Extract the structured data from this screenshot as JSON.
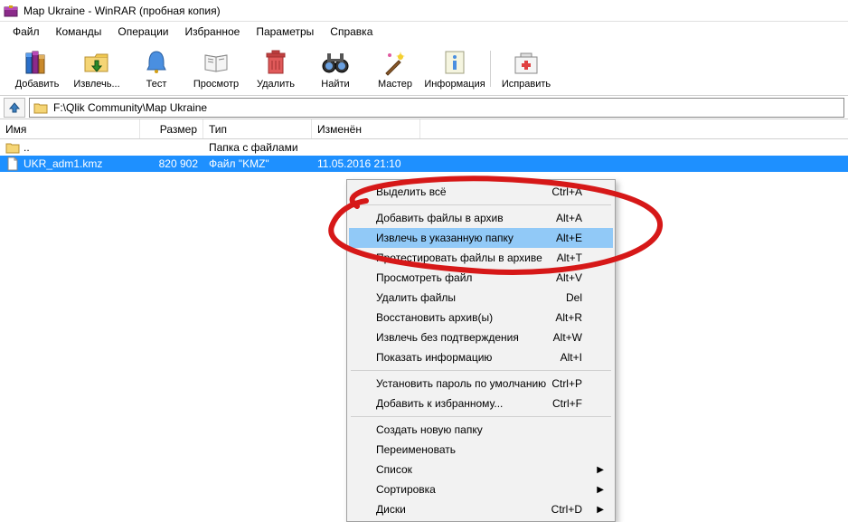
{
  "window": {
    "title": "Map Ukraine - WinRAR (пробная копия)"
  },
  "menu": {
    "file": "Файл",
    "commands": "Команды",
    "operations": "Операции",
    "favorites": "Избранное",
    "options": "Параметры",
    "help": "Справка"
  },
  "toolbar": {
    "add": "Добавить",
    "extract": "Извлечь...",
    "test": "Тест",
    "view": "Просмотр",
    "delete": "Удалить",
    "find": "Найти",
    "wizard": "Мастер",
    "info": "Информация",
    "repair": "Исправить"
  },
  "address": {
    "path": "F:\\Qlik Community\\Map Ukraine"
  },
  "columns": {
    "name": "Имя",
    "size": "Размер",
    "type": "Тип",
    "modified": "Изменён"
  },
  "rows": {
    "parent_name": "..",
    "parent_type": "Папка с файлами",
    "file_name": "UKR_adm1.kmz",
    "file_size": "820 902",
    "file_type": "Файл \"KMZ\"",
    "file_modified": "11.05.2016 21:10"
  },
  "ctx": {
    "select_all": "Выделить всё",
    "select_all_key": "Ctrl+A",
    "add_to_archive": "Добавить файлы в архив",
    "add_to_archive_key": "Alt+A",
    "extract_to": "Извлечь в указанную папку",
    "extract_to_key": "Alt+E",
    "test_files": "Протестировать файлы в архиве",
    "test_files_key": "Alt+T",
    "view_file": "Просмотреть файл",
    "view_file_key": "Alt+V",
    "delete_files": "Удалить файлы",
    "delete_files_key": "Del",
    "repair_archives": "Восстановить архив(ы)",
    "repair_archives_key": "Alt+R",
    "extract_no_confirm": "Извлечь без подтверждения",
    "extract_no_confirm_key": "Alt+W",
    "show_info": "Показать информацию",
    "show_info_key": "Alt+I",
    "set_password": "Установить пароль по умолчанию",
    "set_password_key": "Ctrl+P",
    "add_favorites": "Добавить к избранному...",
    "add_favorites_key": "Ctrl+F",
    "create_folder": "Создать новую папку",
    "rename": "Переименовать",
    "list": "Список",
    "sort": "Сортировка",
    "disks": "Диски",
    "disks_key": "Ctrl+D"
  }
}
